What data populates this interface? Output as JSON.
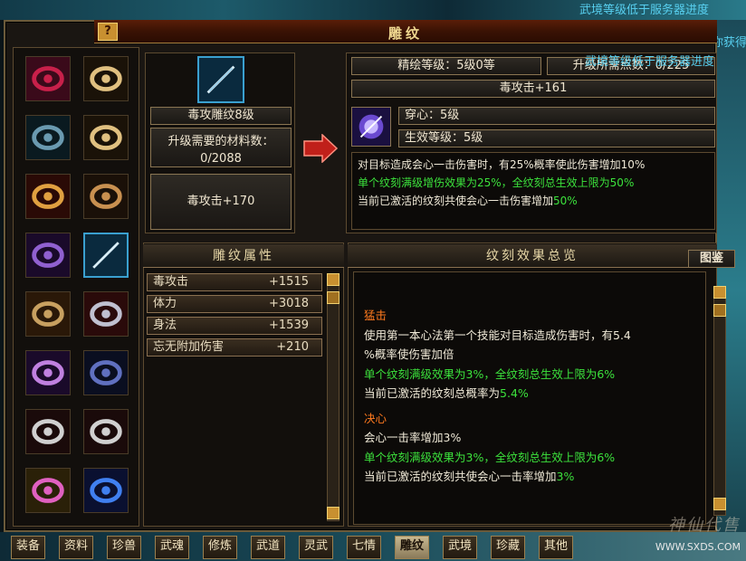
{
  "window": {
    "title": "雕纹",
    "help": "?"
  },
  "notices": {
    "top": "武境等级低于服务器进度",
    "right": "你获得",
    "line2": "武境等级低于服务器进度"
  },
  "item": {
    "name": "毒攻雕纹8级",
    "materials_label": "升级需要的材料数：",
    "materials_value": "0/2088",
    "effect": "毒攻击+170"
  },
  "info": {
    "level": "精绘等级：5级0等",
    "points": "升级所需点数：0/225",
    "bonus": "毒攻击+161",
    "pierce": "穿心：5级",
    "effect_level": "生效等级：5级",
    "desc1": "对目标造成会心一击伤害时，有25%概率使此伤害增加10%",
    "desc2": "单个纹刻满级增伤效果为25%，全纹刻总生效上限为50%",
    "desc3_a": "当前已激活的纹刻共使会心一击伤害增加",
    "desc3_b": "50%"
  },
  "attrs": {
    "title": "雕纹属性",
    "rows": [
      {
        "name": "毒攻击",
        "value": "+1515"
      },
      {
        "name": "体力",
        "value": "+3018"
      },
      {
        "name": "身法",
        "value": "+1539"
      },
      {
        "name": "忘无附加伤害",
        "value": "+210"
      }
    ]
  },
  "overview": {
    "title": "纹刻效果总览",
    "button": "图鉴",
    "s1_title": "猛击",
    "s1_l1": "使用第一本心法第一个技能对目标造成伤害时，有5.4",
    "s1_l2": "%概率使伤害加倍",
    "s1_l3": "单个纹刻满级效果为3%，全纹刻总生效上限为6%",
    "s1_l4a": "当前已激活的纹刻总概率为",
    "s1_l4b": "5.4%",
    "s2_title": "决心",
    "s2_l1": "会心一击率增加3%",
    "s2_l2": "单个纹刻满级效果为3%，全纹刻总生效上限为6%",
    "s2_l3a": "当前已激活的纹刻共使会心一击率增加",
    "s2_l3b": "3%"
  },
  "tabs": [
    "装备",
    "资料",
    "珍兽",
    "武魂",
    "修炼",
    "武道",
    "灵武",
    "七情",
    "雕纹",
    "武境",
    "珍藏",
    "其他"
  ],
  "active_tab": "雕纹",
  "watermark": {
    "logo": "神仙代售",
    "url": "WWW.SXDS.COM"
  }
}
